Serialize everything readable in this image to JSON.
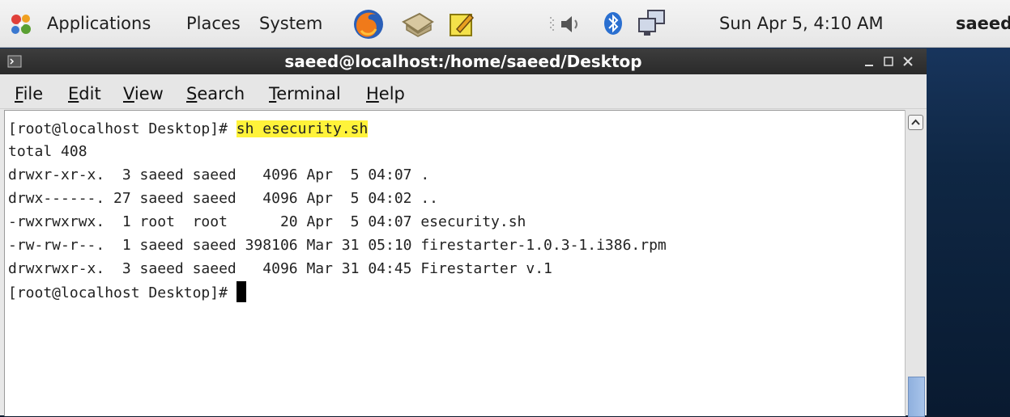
{
  "panel": {
    "applications": "Applications",
    "places": "Places",
    "system": "System",
    "datetime": "Sun Apr  5,  4:10 AM",
    "user": "saeed",
    "icons": [
      "gnome-foot-icon",
      "firefox-icon",
      "evolution-mail-icon",
      "notes-icon",
      "volume-icon",
      "bluetooth-icon",
      "network-icon"
    ]
  },
  "window": {
    "title": "saeed@localhost:/home/saeed/Desktop",
    "menus": [
      {
        "mnemonic": "F",
        "rest": "ile"
      },
      {
        "mnemonic": "E",
        "rest": "dit"
      },
      {
        "mnemonic": "V",
        "rest": "iew"
      },
      {
        "mnemonic": "S",
        "rest": "earch"
      },
      {
        "mnemonic": "T",
        "rest": "erminal"
      },
      {
        "mnemonic": "H",
        "rest": "elp"
      }
    ]
  },
  "terminal": {
    "prompt": "[root@localhost Desktop]# ",
    "command": "sh esecurity.sh",
    "output": [
      "total 408",
      "drwxr-xr-x.  3 saeed saeed   4096 Apr  5 04:07 .",
      "drwx------. 27 saeed saeed   4096 Apr  5 04:02 ..",
      "-rwxrwxrwx.  1 root  root      20 Apr  5 04:07 esecurity.sh",
      "-rw-rw-r--.  1 saeed saeed 398106 Mar 31 05:10 firestarter-1.0.3-1.i386.rpm",
      "drwxrwxr-x.  3 saeed saeed   4096 Mar 31 04:45 Firestarter v.1"
    ],
    "final_prompt": "[root@localhost Desktop]# "
  },
  "colors": {
    "highlight": "#fff33a",
    "titlebar": "#2f2f2f",
    "panel": "#eeeeee"
  }
}
